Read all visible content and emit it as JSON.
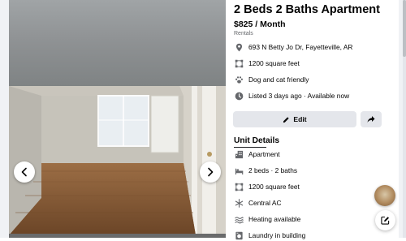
{
  "listing": {
    "title": "2 Beds 2 Baths Apartment",
    "price": "$825 / Month",
    "category": "Rentals"
  },
  "info_rows": [
    {
      "icon": "map-pin-icon",
      "text": "693 N Betty Jo Dr, Fayetteville, AR"
    },
    {
      "icon": "area-icon",
      "text": "1200 square feet"
    },
    {
      "icon": "paw-icon",
      "text": "Dog and cat friendly"
    },
    {
      "icon": "clock-icon",
      "text": "Listed 3 days ago · Available now"
    }
  ],
  "actions": {
    "edit_label": "Edit",
    "share_icon": "share-arrow-icon"
  },
  "unit_details": {
    "title": "Unit Details",
    "items": [
      {
        "icon": "building-icon",
        "text": "Apartment"
      },
      {
        "icon": "bed-icon",
        "text": "2 beds · 2 baths"
      },
      {
        "icon": "area-icon",
        "text": "1200 square feet"
      },
      {
        "icon": "snowflake-icon",
        "text": "Central AC"
      },
      {
        "icon": "heat-icon",
        "text": "Heating available"
      },
      {
        "icon": "laundry-icon",
        "text": "Laundry in building"
      }
    ]
  },
  "gallery": {
    "prev_icon": "chevron-left-icon",
    "next_icon": "chevron-right-icon"
  },
  "floating": {
    "avatar": "listing-thumbnail",
    "compose_icon": "compose-icon"
  },
  "colors": {
    "text": "#050505",
    "secondary_text": "#65676b",
    "button_bg": "#e4e6eb",
    "icon_gray": "#65676b",
    "page_bg": "#f0f2f5"
  }
}
